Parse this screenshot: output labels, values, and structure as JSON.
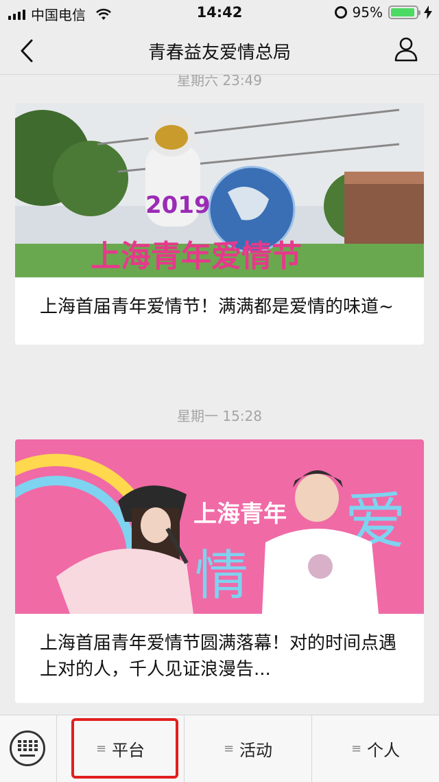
{
  "status_bar": {
    "carrier": "中国电信",
    "time": "14:42",
    "battery": "95%",
    "battery_level": 0.95
  },
  "nav": {
    "title": "青春益友爱情总局"
  },
  "feed": [
    {
      "timestamp": "星期六 23:49",
      "image_text": "2019",
      "image_caption": "上海青年爱情节",
      "title": "上海首届青年爱情节！满满都是爱情的味道~"
    },
    {
      "timestamp": "星期一 15:28",
      "image_text": "上海青年",
      "image_big": "爱",
      "image_big2": "情",
      "title": "上海首届青年爱情节圆满落幕！对的时间点遇上对的人，千人见证浪漫告..."
    }
  ],
  "menu": [
    {
      "label": "平台"
    },
    {
      "label": "活动"
    },
    {
      "label": "个人"
    }
  ],
  "colors": {
    "highlight": "#e21f1f",
    "background": "#ededed"
  }
}
